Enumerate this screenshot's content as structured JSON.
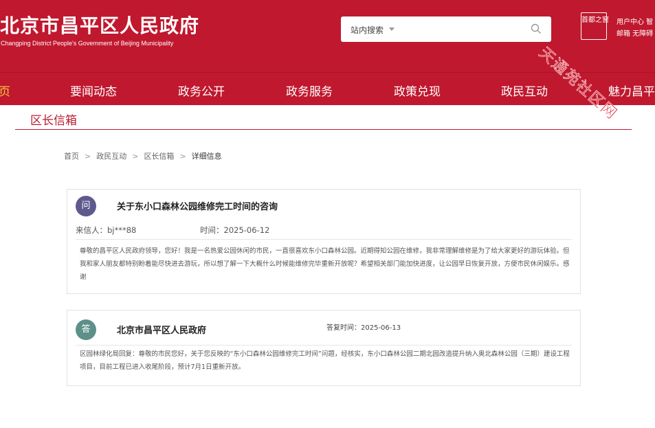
{
  "header": {
    "title_cn": "北京市昌平区人民政府",
    "title_en": "Changping District People's Government of Beijing Municipality",
    "search": {
      "scope_label": "站内搜索",
      "placeholder": ""
    },
    "badge_text": "首都之窗",
    "user_links": [
      "用户中心  智",
      "邮箱  无障碍"
    ]
  },
  "nav": {
    "items": [
      "页",
      "要闻动态",
      "政务公开",
      "政务服务",
      "政策兑现",
      "政民互动",
      "魅力昌平"
    ]
  },
  "watermark": "天通苑社区网",
  "section": {
    "title": "区长信箱"
  },
  "breadcrumb": {
    "items": [
      "首页",
      "政民互动",
      "区长信箱"
    ],
    "separator": ">",
    "current": "详细信息"
  },
  "question": {
    "avatar": "问",
    "title": "关于东小口森林公园维修完工时间的咨询",
    "sender": "来信人：bj***88",
    "time": "时间：2025-06-12",
    "body": "尊敬的昌平区人民政府领导，您好！我是一名热爱公园休闲的市民，一直很喜欢东小口森林公园。近期得知公园在维修，我非常理解维修是为了给大家更好的游玩体验。但我和家人朋友都特别盼着能尽快进去游玩，所以想了解一下大概什么时候能维修完毕重新开放呢？希望相关部门能加快进度，让公园早日恢复开放，方便市民休闲娱乐。感谢"
  },
  "answer": {
    "avatar": "答",
    "title": "北京市昌平区人民政府",
    "reply_time": "答复时间：2025-06-13",
    "body": "区园林绿化局回复：尊敬的市民您好，关于您反映的“东小口森林公园维修完工时间”问题，经核实，东小口森林公园二期北园改造提升纳入奥北森林公园（三期）建设工程项目，目前工程已进入收尾阶段，预计7月1日重新开放。"
  },
  "colors": {
    "brand_red": "#c0182e",
    "nav_active": "#f5c542",
    "avatar_question": "#5e5a8e",
    "avatar_answer": "#5c9088"
  }
}
